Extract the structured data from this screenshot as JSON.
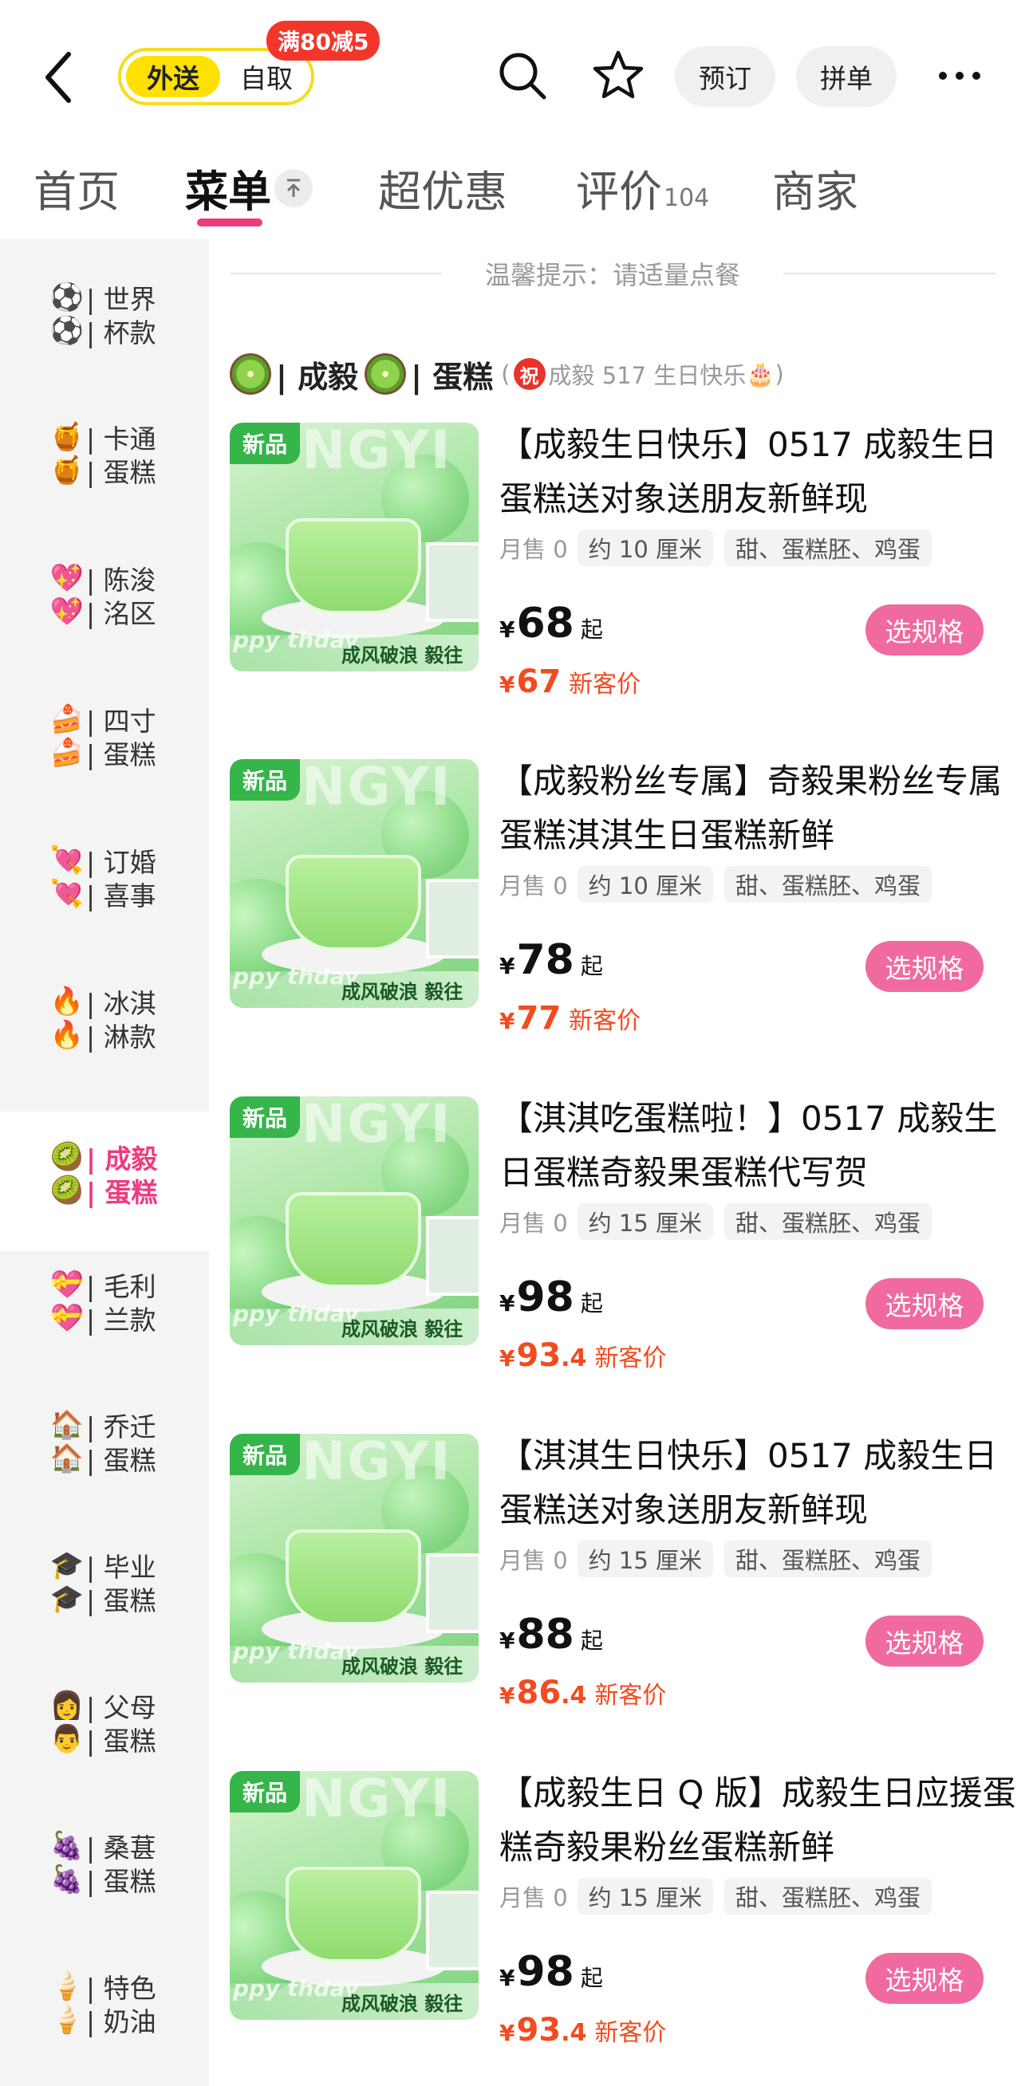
{
  "header": {
    "mode_active": "外送",
    "mode_inactive": "自取",
    "promo": "满80减5",
    "reserve": "预订",
    "group_order": "拼单"
  },
  "tabs": [
    {
      "label": "首页"
    },
    {
      "label": "菜单"
    },
    {
      "label": "超优惠"
    },
    {
      "label": "评价",
      "count": "104"
    },
    {
      "label": "商家"
    }
  ],
  "sidebar": [
    {
      "emoji": "⚽",
      "line1": "世界",
      "line2": "杯款"
    },
    {
      "emoji": "🍯",
      "line1": "卡通",
      "line2": "蛋糕"
    },
    {
      "emoji": "💖",
      "line1": "陈浚",
      "line2": "洺区"
    },
    {
      "emoji": "🍰",
      "line1": "四寸",
      "line2": "蛋糕"
    },
    {
      "emoji": "💘",
      "line1": "订婚",
      "line2": "喜事"
    },
    {
      "emoji": "🔥",
      "line1": "冰淇",
      "line2": "淋款"
    },
    {
      "emoji": "🥝",
      "line1": "成毅",
      "line2": "蛋糕"
    },
    {
      "emoji": "💝",
      "line1": "毛利",
      "line2": "兰款"
    },
    {
      "emoji": "🏠",
      "line1": "乔迁",
      "line2": "蛋糕"
    },
    {
      "emoji": "🎓",
      "line1": "毕业",
      "line2": "蛋糕"
    },
    {
      "emoji": "👩",
      "emoji2": "👨",
      "line1": "父母",
      "line2": "蛋糕"
    },
    {
      "emoji": "🍇",
      "line1": "桑葚",
      "line2": "蛋糕"
    },
    {
      "emoji": "🍦",
      "line1": "特色",
      "line2": "奶油"
    }
  ],
  "tip": "温馨提示：请适量点餐",
  "category": {
    "title_a": "| 成毅",
    "title_b": "| 蛋糕",
    "note_badge": "祝",
    "note_text": "成毅 517 生日快乐",
    "note_emoji": "🎂",
    "note_open": "(",
    "note_close": ")"
  },
  "products": [
    {
      "badge": "新品",
      "title": "【成毅生日快乐】0517 成毅生日蛋糕送对象送朋友新鲜现",
      "sold": "月售 0",
      "size": "约 10 厘米",
      "tags": "甜、蛋糕胚、鸡蛋",
      "currency": "¥",
      "price": "68",
      "price_suffix": "起",
      "new_int": "67",
      "new_dec": "",
      "new_label": "新客价",
      "button": "选规格"
    },
    {
      "badge": "新品",
      "title": "【成毅粉丝专属】奇毅果粉丝专属蛋糕淇淇生日蛋糕新鲜",
      "sold": "月售 0",
      "size": "约 10 厘米",
      "tags": "甜、蛋糕胚、鸡蛋",
      "currency": "¥",
      "price": "78",
      "price_suffix": "起",
      "new_int": "77",
      "new_dec": "",
      "new_label": "新客价",
      "button": "选规格"
    },
    {
      "badge": "新品",
      "title": "【淇淇吃蛋糕啦！】0517 成毅生日蛋糕奇毅果蛋糕代写贺",
      "sold": "月售 0",
      "size": "约 15 厘米",
      "tags": "甜、蛋糕胚、鸡蛋",
      "currency": "¥",
      "price": "98",
      "price_suffix": "起",
      "new_int": "93",
      "new_dec": ".4",
      "new_label": "新客价",
      "button": "选规格"
    },
    {
      "badge": "新品",
      "title": "【淇淇生日快乐】0517 成毅生日蛋糕送对象送朋友新鲜现",
      "sold": "月售 0",
      "size": "约 15 厘米",
      "tags": "甜、蛋糕胚、鸡蛋",
      "currency": "¥",
      "price": "88",
      "price_suffix": "起",
      "new_int": "86",
      "new_dec": ".4",
      "new_label": "新客价",
      "button": "选规格"
    },
    {
      "badge": "新品",
      "title": "【成毅生日 Q 版】成毅生日应援蛋糕奇毅果粉丝蛋糕新鲜",
      "sold": "月售 0",
      "size": "约 15 厘米",
      "tags": "甜、蛋糕胚、鸡蛋",
      "currency": "¥",
      "price": "98",
      "price_suffix": "起",
      "new_int": "93",
      "new_dec": ".4",
      "new_label": "新客价",
      "button": "选规格"
    }
  ],
  "image_text": {
    "watermark": "NGYI",
    "slogan": "成风破浪 毅往",
    "hb": "ppy thday"
  },
  "colors": {
    "accent_pink": "#f03a7e",
    "button_pink": "#f06a9f",
    "price_red": "#f34a1f",
    "toggle_yellow": "#ffe100",
    "promo_red": "#f3362b",
    "new_green": "#35b54a"
  }
}
